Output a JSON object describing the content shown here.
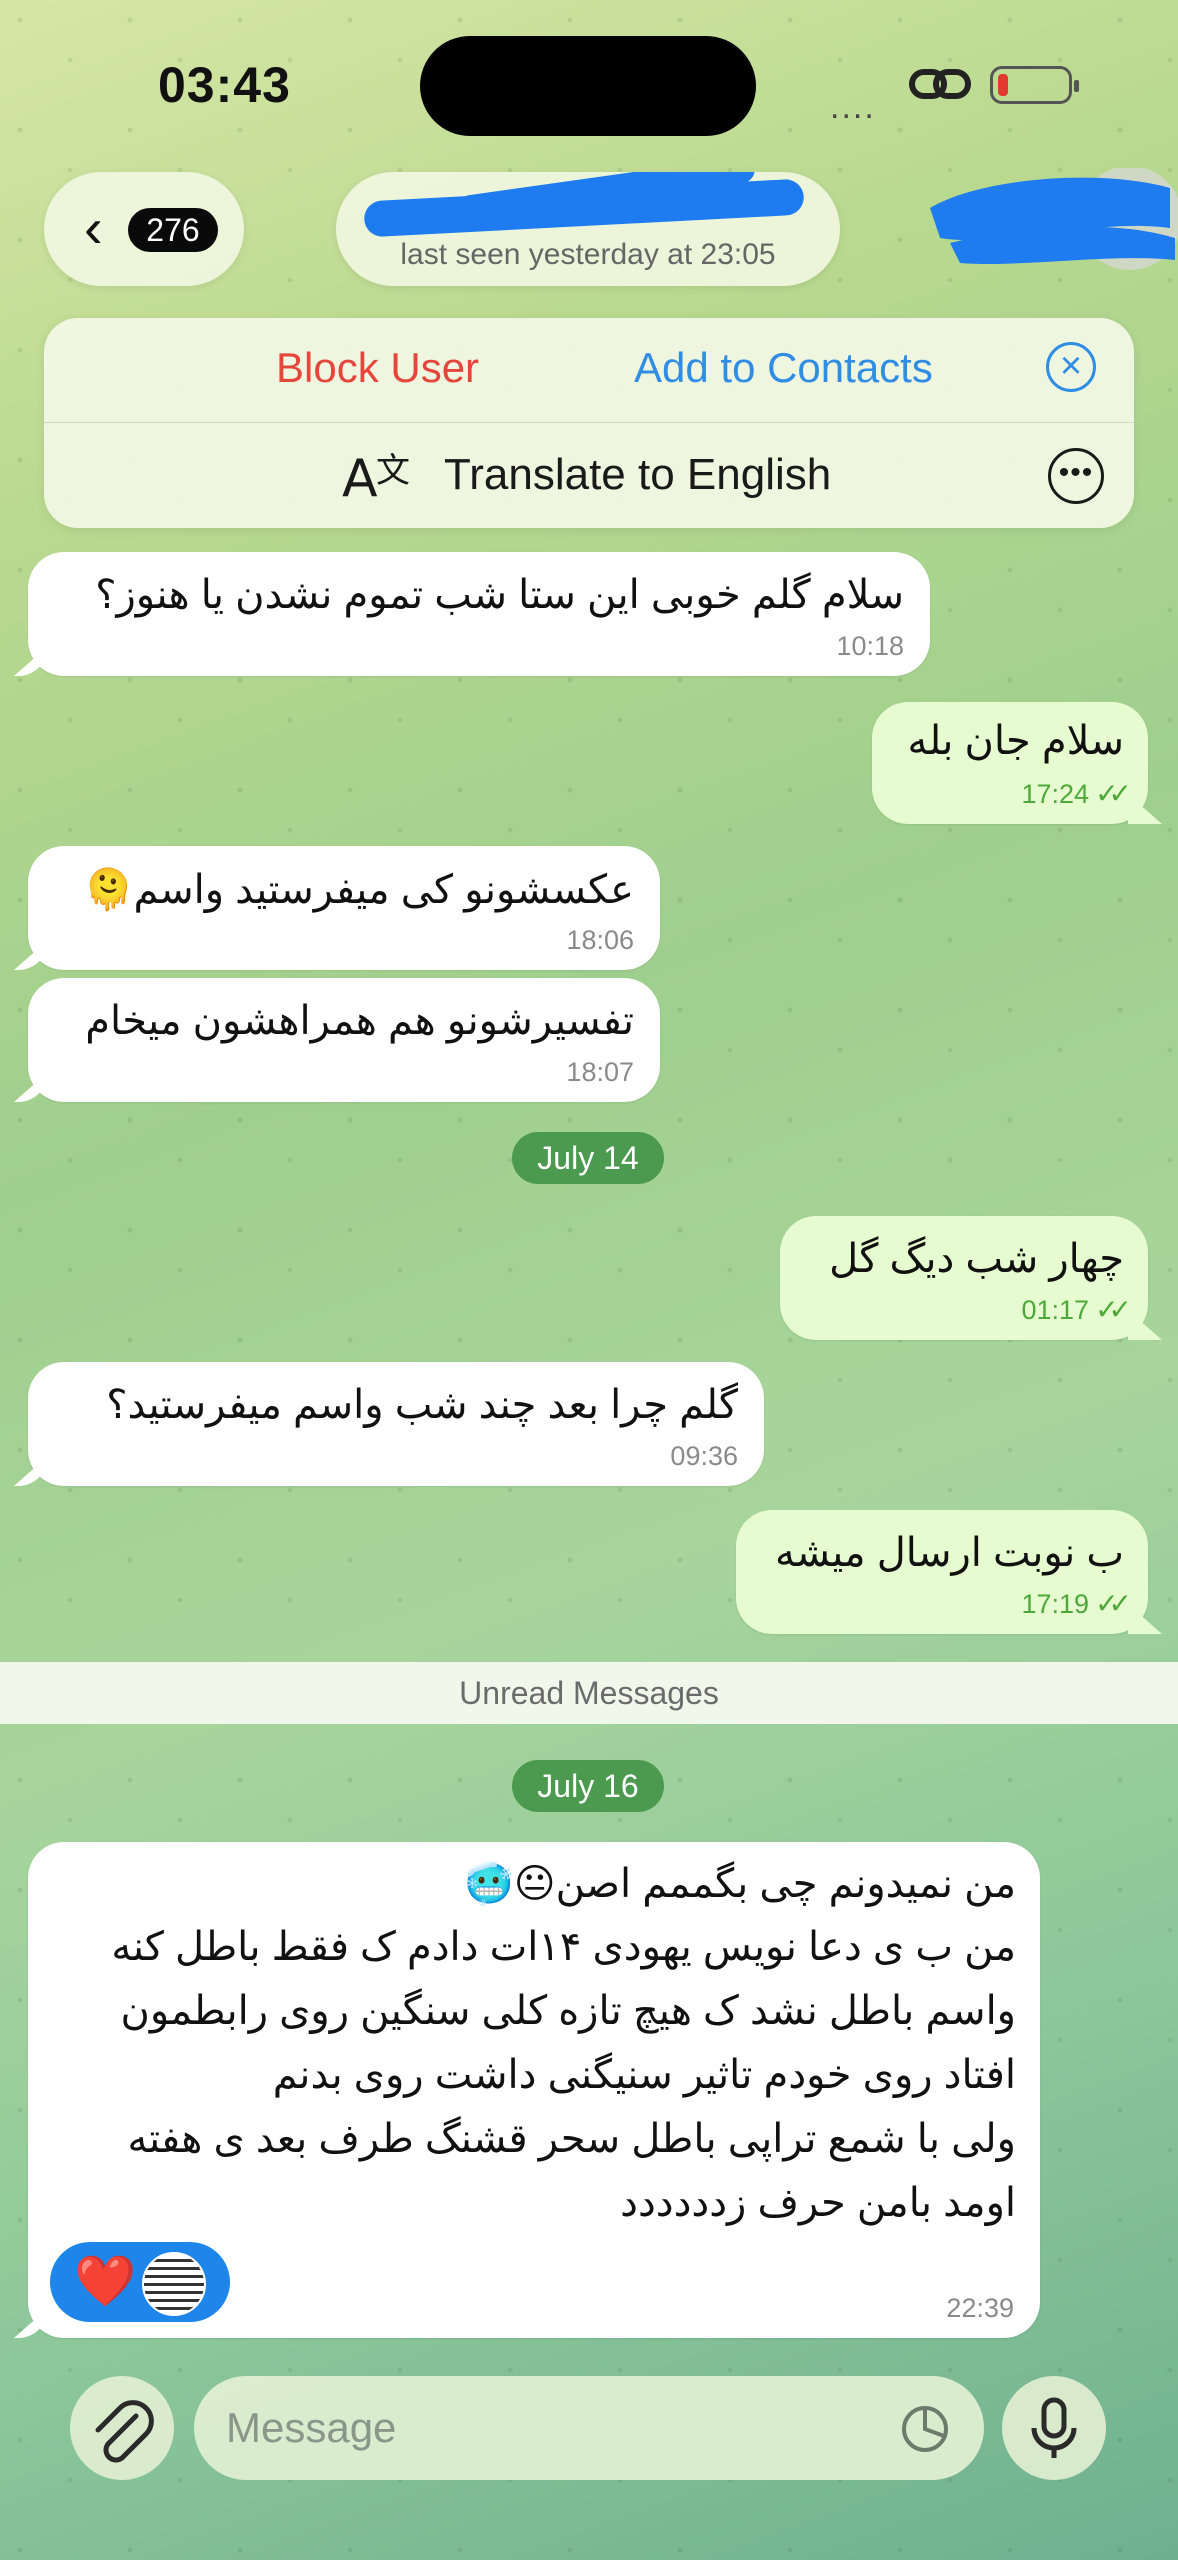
{
  "status_bar": {
    "time": "03:43",
    "signal": "....",
    "link_icon": "link-icon",
    "battery_level_percent": 10
  },
  "header": {
    "back_count": "276",
    "last_seen": "last seen yesterday at 23:05"
  },
  "actions": {
    "block": "Block User",
    "add_contact": "Add to Contacts",
    "close_icon": "close-circle-icon",
    "translate": "Translate to English",
    "more_icon": "more-ellipsis-icon"
  },
  "messages": [
    {
      "dir": "in",
      "text": "سلام گلم خوبی این ستا شب تموم نشدن یا هنوز؟",
      "time": "10:18"
    },
    {
      "dir": "out",
      "text": "سلام جان بله",
      "time": "17:24"
    },
    {
      "dir": "in",
      "text": "عکسشونو کی میفرستید واسم🫠",
      "time": "18:06"
    },
    {
      "dir": "in",
      "text": "تفسیرشونو هم همراهشون میخام",
      "time": "18:07"
    },
    {
      "dir": "out",
      "text": "چهار شب دیگ گل",
      "time": "01:17"
    },
    {
      "dir": "in",
      "text": "گلم چرا بعد چند شب واسم میفرستید؟",
      "time": "09:36"
    },
    {
      "dir": "out",
      "text": "ب نوبت ارسال میشه",
      "time": "17:19"
    }
  ],
  "dates": {
    "first": "July 14",
    "second": "July 16"
  },
  "unread_label": "Unread Messages",
  "long_message": {
    "lines": [
      "من نمیدونم چی بگممم اصن😐🥶",
      "من ب ی دعا نویس یهودی ۱۴ات دادم ک فقط باطل کنه",
      "واسم باطل نشد ک هیچ تازه کلی سنگین روی رابطمون",
      "افتاد روی خودم تاثیر سنیگنی داشت روی بدنم",
      "ولی با شمع تراپی باطل سحر قشنگ طرف بعد ی هفته",
      "اومد بامن حرف زدددددد"
    ],
    "time": "22:39",
    "reaction": "❤️"
  },
  "composer": {
    "placeholder": "Message",
    "attach_icon": "paperclip-icon",
    "sticker_icon": "sticker-icon",
    "mic_icon": "microphone-icon"
  },
  "colors": {
    "incoming_bubble": "#ffffff",
    "outgoing_bubble": "#e6fbcf",
    "accent_blue": "#2f8de4",
    "danger_red": "#e5463c",
    "date_pill": "#4c9a4f",
    "read_ticks": "#4ea83a"
  }
}
